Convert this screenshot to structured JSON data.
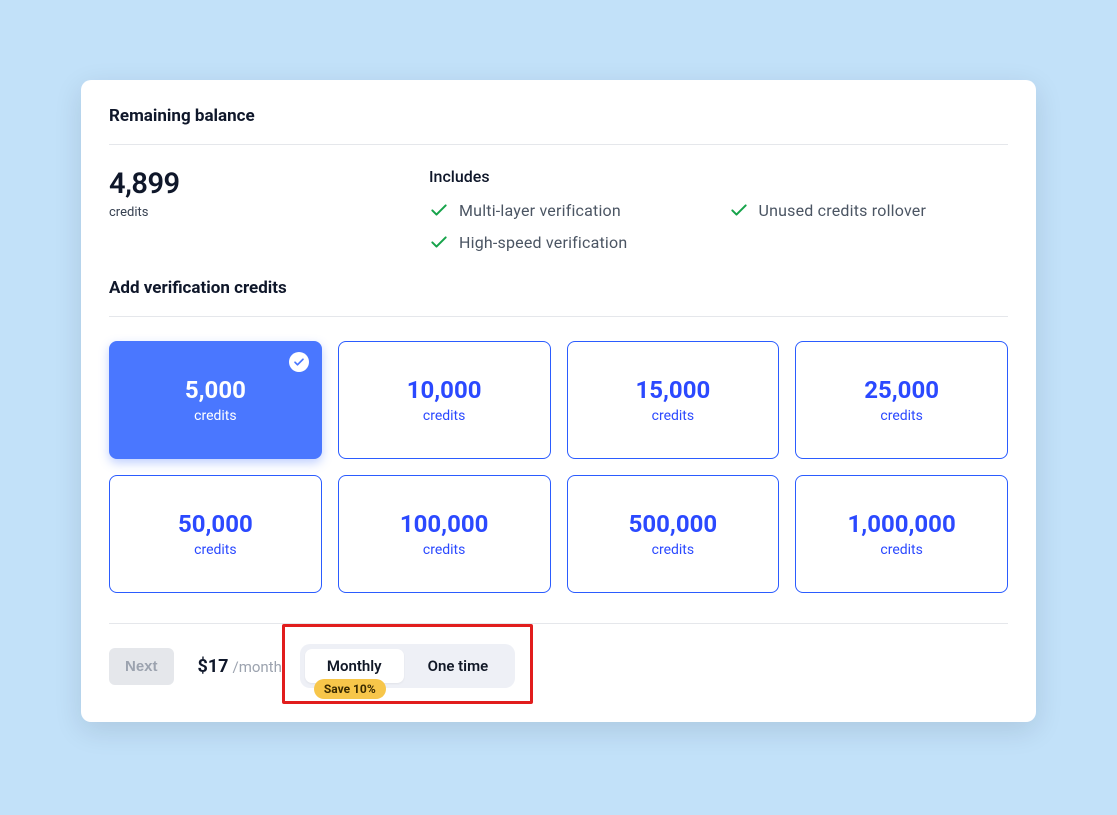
{
  "balance": {
    "title": "Remaining balance",
    "value": "4,899",
    "unit": "credits"
  },
  "includes": {
    "title": "Includes",
    "items": [
      "Multi-layer verification",
      "Unused credits rollover",
      "High-speed verification"
    ]
  },
  "add_section": {
    "title": "Add verification credits",
    "unit_label": "credits",
    "tiles": [
      {
        "amount": "5,000",
        "selected": true
      },
      {
        "amount": "10,000",
        "selected": false
      },
      {
        "amount": "15,000",
        "selected": false
      },
      {
        "amount": "25,000",
        "selected": false
      },
      {
        "amount": "50,000",
        "selected": false
      },
      {
        "amount": "100,000",
        "selected": false
      },
      {
        "amount": "500,000",
        "selected": false
      },
      {
        "amount": "1,000,000",
        "selected": false
      }
    ]
  },
  "footer": {
    "next_label": "Next",
    "price": "$17",
    "period": "/month",
    "toggle": {
      "options": [
        "Monthly",
        "One time"
      ],
      "active_index": 0,
      "save_badge": "Save 10%"
    }
  },
  "colors": {
    "page_bg": "#c2e1f9",
    "accent": "#2b5cff",
    "tile_selected": "#4a77ff",
    "badge": "#f7c64a",
    "check_green": "#16a34a",
    "annotation": "#e11d1d"
  }
}
